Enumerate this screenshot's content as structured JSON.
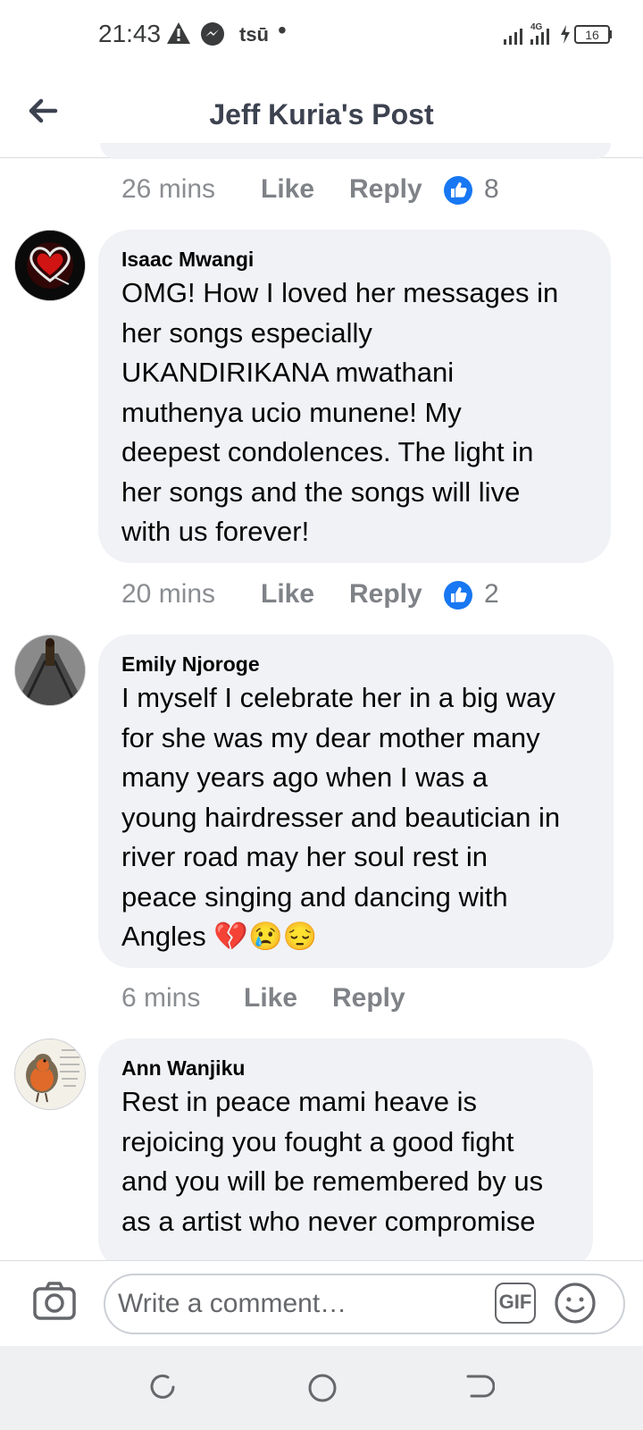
{
  "status_bar": {
    "time": "21:43",
    "app_label": "tsū",
    "network": "4G",
    "battery": "16"
  },
  "header": {
    "title": "Jeff Kuria's Post"
  },
  "comments": [
    {
      "time": "26 mins",
      "like": "Like",
      "reply": "Reply",
      "reactions": "8"
    },
    {
      "author": "Isaac Mwangi",
      "lines": [
        "OMG!  How I loved her messages in",
        "her songs especially",
        "UKANDIRIKANA  mwathani",
        "muthenya ucio munene!  My",
        "deepest condolences. The light in",
        "her songs and the songs will live",
        "with us forever!"
      ],
      "time": "20 mins",
      "like": "Like",
      "reply": "Reply",
      "reactions": "2"
    },
    {
      "author": "Emily Njoroge",
      "lines": [
        "I myself I celebrate her in a big way",
        "for she was my dear mother many",
        "many years ago when I was a",
        "young hairdresser and beautician in",
        "river road may her soul rest in",
        "peace singing and dancing with",
        "Angles 💔😢😔"
      ],
      "time": "6 mins",
      "like": "Like",
      "reply": "Reply"
    },
    {
      "author": "Ann Wanjiku",
      "lines": [
        "Rest in peace mami heave is",
        "rejoicing you fought a good fight",
        "and you will be remembered by us",
        "as a artist who never compromise"
      ]
    }
  ],
  "composer": {
    "placeholder": "Write a comment…",
    "gif_label": "GIF"
  },
  "colors": {
    "like_blue": "#1877f2",
    "bubble": "#f0f2f5",
    "header_text": "#3d4250"
  }
}
